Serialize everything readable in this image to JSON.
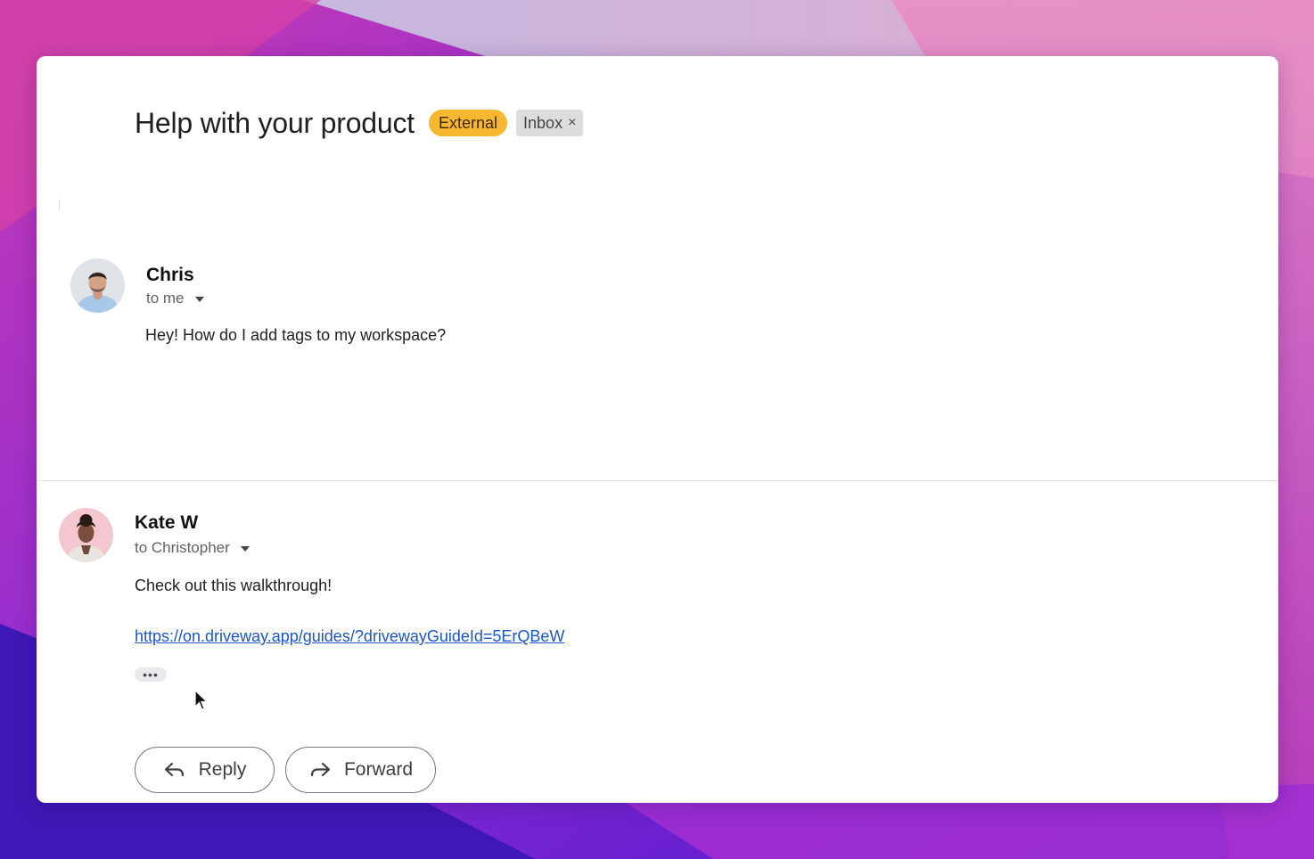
{
  "colors": {
    "external_label": "#f7b731",
    "inbox_label": "#dddddd",
    "link": "#1a56c7"
  },
  "thread": {
    "subject": "Help with your product",
    "labels": {
      "external": "External",
      "inbox": "Inbox",
      "inbox_remove_icon": "close-icon",
      "inbox_remove_glyph": "×"
    }
  },
  "messages": [
    {
      "sender": "Chris",
      "recipient": "to me",
      "body": "Hey! How do I add tags to my workspace?",
      "avatar_icon": "avatar-photo"
    },
    {
      "sender": "Kate W",
      "recipient": "to Christopher",
      "body": "Check out this walkthrough!",
      "link": "https://on.driveway.app/guides/?drivewayGuideId=5ErQBeW",
      "more_label": "•••",
      "avatar_icon": "avatar-photo"
    }
  ],
  "actions": {
    "reply": {
      "label": "Reply",
      "icon": "reply-icon"
    },
    "forward": {
      "label": "Forward",
      "icon": "forward-icon"
    }
  }
}
